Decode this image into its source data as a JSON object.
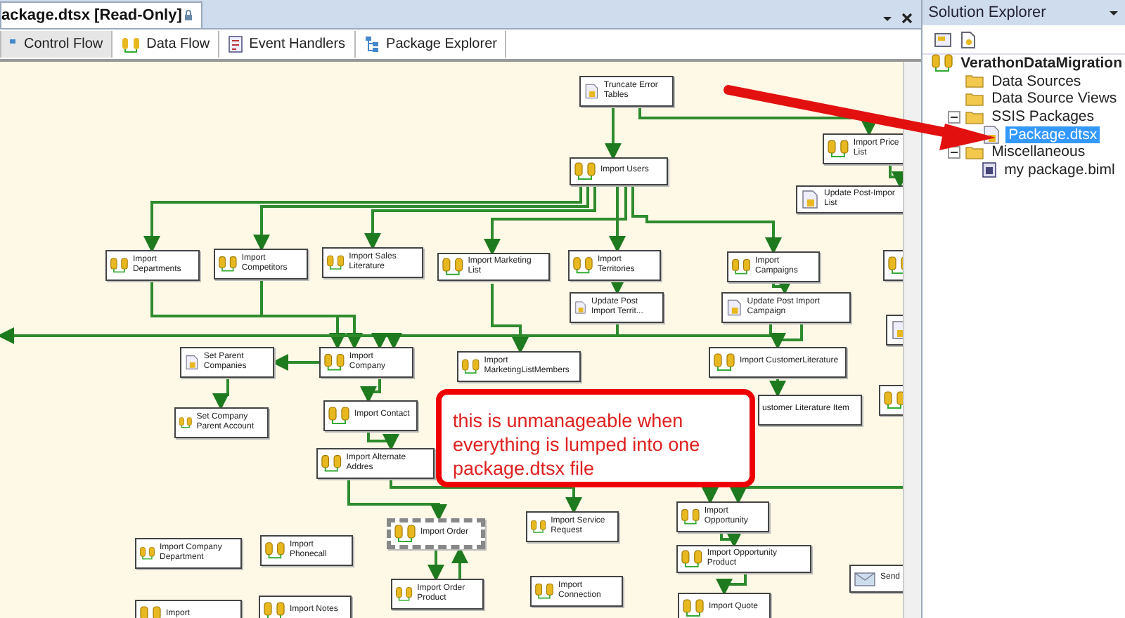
{
  "document_tab": {
    "title": "ackage.dtsx [Read-Only]",
    "read_only": true
  },
  "designer_tabs": [
    {
      "label": "Control Flow",
      "kind": "control",
      "selected": true
    },
    {
      "label": "Data Flow",
      "kind": "data",
      "selected": false
    },
    {
      "label": "Event Handlers",
      "kind": "events",
      "selected": false
    },
    {
      "label": "Package Explorer",
      "kind": "explorer",
      "selected": false
    }
  ],
  "nodes": [
    {
      "label": "Truncate Error Tables",
      "kind": "script",
      "selected": false
    },
    {
      "label": "Import Price List",
      "kind": "dataflow",
      "selected": false
    },
    {
      "label": "Update Post-Impor List",
      "kind": "script",
      "selected": false
    },
    {
      "label": "Import Users",
      "kind": "dataflow",
      "selected": false
    },
    {
      "label": "Import Departments",
      "kind": "dataflow",
      "selected": false
    },
    {
      "label": "Import Competitors",
      "kind": "dataflow",
      "selected": false
    },
    {
      "label": "Import Sales Literature",
      "kind": "dataflow",
      "selected": false
    },
    {
      "label": "Import Marketing List",
      "kind": "dataflow",
      "selected": false
    },
    {
      "label": "Import Territories",
      "kind": "dataflow",
      "selected": false
    },
    {
      "label": "Import Campaigns",
      "kind": "dataflow",
      "selected": false
    },
    {
      "kind": "dataflow",
      "selected": false
    },
    {
      "label": "Update Post Import Territ...",
      "kind": "script",
      "selected": false
    },
    {
      "label": "Update Post Import Campaign",
      "kind": "script",
      "selected": false
    },
    {
      "kind": "script",
      "selected": false
    },
    {
      "label": "Set Parent Companies",
      "kind": "script",
      "selected": false
    },
    {
      "label": "Import Company",
      "kind": "dataflow",
      "selected": false
    },
    {
      "label": "Import MarketingListMembers",
      "kind": "dataflow",
      "selected": false
    },
    {
      "label": "Import CustomerLiterature",
      "kind": "dataflow",
      "selected": false
    },
    {
      "kind": "dataflow",
      "selected": false
    },
    {
      "label": "Set Company Parent Account",
      "kind": "dataflow",
      "selected": false
    },
    {
      "label": "Import Contact",
      "kind": "dataflow",
      "selected": false
    },
    {
      "label": "ustomer Literature Item",
      "kind": "plain",
      "selected": false
    },
    {
      "label": "Import Alternate Addres",
      "kind": "dataflow",
      "selected": false
    },
    {
      "label": "Import Company Department",
      "kind": "dataflow",
      "selected": false
    },
    {
      "label": "Import Phonecall",
      "kind": "dataflow",
      "selected": false
    },
    {
      "label": "Import Order",
      "kind": "dataflow",
      "selected": true
    },
    {
      "label": "Import Service Request",
      "kind": "dataflow",
      "selected": false
    },
    {
      "label": "Import Opportunity",
      "kind": "dataflow",
      "selected": false
    },
    {
      "label": "Import Opportunity Product",
      "kind": "dataflow",
      "selected": false
    },
    {
      "label": "Send",
      "kind": "send",
      "selected": false
    },
    {
      "label": "Import",
      "kind": "dataflow",
      "selected": false
    },
    {
      "label": "Import Notes",
      "kind": "dataflow",
      "selected": false
    },
    {
      "label": "Import Order Product",
      "kind": "dataflow",
      "selected": false
    },
    {
      "label": "Import Connection",
      "kind": "dataflow",
      "selected": false
    },
    {
      "label": "Import Quote",
      "kind": "dataflow",
      "selected": false
    }
  ],
  "callout": {
    "text": "this is unmanageable when everything is lumped into one package.dtsx file"
  },
  "solution_explorer": {
    "title": "Solution Explorer",
    "root": {
      "label": "VerathonDataMigration",
      "kind": "project",
      "children": [
        {
          "label": "Data Sources",
          "kind": "folder"
        },
        {
          "label": "Data Source Views",
          "kind": "folder"
        },
        {
          "label": "SSIS Packages",
          "kind": "folder",
          "expanded": true,
          "children": [
            {
              "label": "Package.dtsx",
              "kind": "package",
              "selected": true
            }
          ]
        },
        {
          "label": "Miscellaneous",
          "kind": "folder",
          "expanded": true,
          "children": [
            {
              "label": "my package.biml",
              "kind": "file",
              "selected": false
            }
          ]
        }
      ]
    }
  }
}
